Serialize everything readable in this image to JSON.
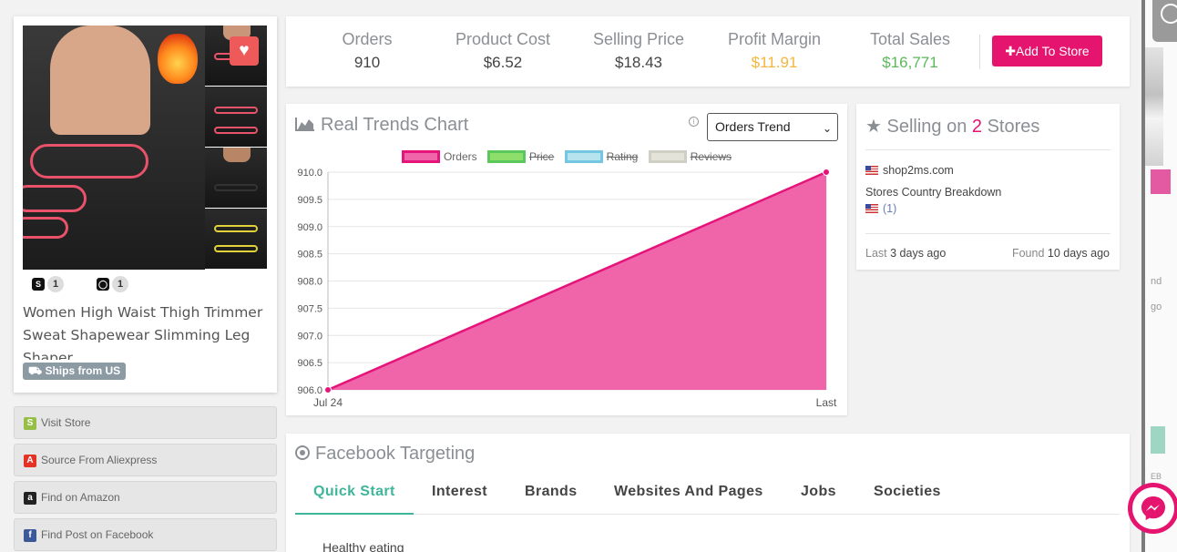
{
  "product": {
    "title": "Women High Waist Thigh Trimmer Sweat Shapewear Slimming Leg Shaper",
    "shipping_badge": "Ships from US",
    "platforms": [
      {
        "icon": "shopify-icon",
        "count": "1"
      },
      {
        "icon": "store-bag-icon",
        "count": "1"
      }
    ]
  },
  "actions": [
    {
      "label": "Visit Store",
      "icon": "shopify-icon",
      "color": "#95bf47"
    },
    {
      "label": "Source From Aliexpress",
      "icon": "aliexpress-icon",
      "color": "#e43225"
    },
    {
      "label": "Find on Amazon",
      "icon": "amazon-icon",
      "color": "#222222"
    },
    {
      "label": "Find Post on Facebook",
      "icon": "facebook-icon",
      "color": "#3b5998"
    }
  ],
  "stats": {
    "orders": {
      "label": "Orders",
      "value": "910"
    },
    "product_cost": {
      "label": "Product Cost",
      "value": "$6.52"
    },
    "selling_price": {
      "label": "Selling Price",
      "value": "$18.43"
    },
    "profit_margin": {
      "label": "Profit Margin",
      "value": "$11.91",
      "color": "#f4b63b"
    },
    "total_sales": {
      "label": "Total Sales",
      "value": "$16,771",
      "color": "#5cb85c"
    },
    "add_button": "Add To Store"
  },
  "trends": {
    "title": "Real Trends Chart",
    "select_value": "Orders Trend",
    "legend": [
      {
        "name": "Orders",
        "color": "#e5147a",
        "fill": "#f065aa",
        "active": true
      },
      {
        "name": "Price",
        "color": "#5cc85c",
        "fill": "#8ede6b",
        "active": false
      },
      {
        "name": "Rating",
        "color": "#73c7e0",
        "fill": "#b7e3ef",
        "active": false
      },
      {
        "name": "Reviews",
        "color": "#cfcfc3",
        "fill": "#e3e3da",
        "active": false
      }
    ]
  },
  "chart_data": {
    "type": "area",
    "x": [
      "Jul 24",
      "Last"
    ],
    "series": [
      {
        "name": "Orders",
        "values": [
          906.0,
          910.0
        ]
      }
    ],
    "y_ticks": [
      "906.0",
      "906.5",
      "907.0",
      "907.5",
      "908.0",
      "908.5",
      "909.0",
      "909.5",
      "910.0"
    ],
    "ylim": [
      906.0,
      910.0
    ],
    "grid": true,
    "legend_position": "top"
  },
  "stores": {
    "title_pre": "Selling on ",
    "count": "2",
    "title_post": " Stores",
    "store_name": "shop2ms.com",
    "breakdown_label": "Stores Country Breakdown",
    "breakdown_count": "(1)",
    "last_label": "Last",
    "last_value": "3 days ago",
    "found_label": "Found",
    "found_value": "10 days ago"
  },
  "facebook": {
    "title": "Facebook Targeting",
    "tabs": [
      "Quick Start",
      "Interest",
      "Brands",
      "Websites And Pages",
      "Jobs",
      "Societies"
    ],
    "active_tab": "Quick Start",
    "first_interest": "Healthy eating"
  },
  "background_fragments": [
    "nd",
    "go",
    "EB"
  ],
  "colors": {
    "accent": "#e5146f",
    "tab_active": "#3fb59b"
  }
}
